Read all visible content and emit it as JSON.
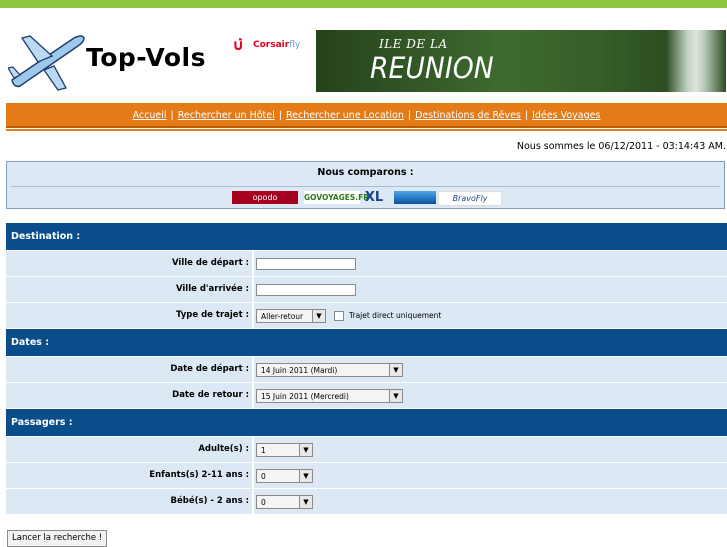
{
  "brand": {
    "logo_text": "Top-Vols"
  },
  "banner": {
    "tui_mark": "∪̇",
    "corsair": "Corsair",
    "corsair_suffix": "fly",
    "line1": "ILE DE LA",
    "line2": "REUNION"
  },
  "nav": {
    "items": [
      "Accueil",
      "Rechercher un Hôtel",
      "Rechercher une Location",
      "Destinations de Rêves",
      "Idées Voyages"
    ],
    "separator": "|"
  },
  "date_line": "Nous sommes le 06/12/2011 - 03:14:43 AM.",
  "compare": {
    "title": "Nous comparons :",
    "partners": [
      "opodo",
      "GOVOYAGES.FR",
      "XL",
      "",
      "BravoFly"
    ]
  },
  "form": {
    "sections": {
      "destination": "Destination :",
      "dates": "Dates :",
      "passagers": "Passagers :"
    },
    "ville_depart": {
      "label": "Ville de départ :",
      "value": ""
    },
    "ville_arrivee": {
      "label": "Ville d'arrivée :",
      "value": ""
    },
    "type_trajet": {
      "label": "Type de trajet :",
      "value": "Aller-retour",
      "checkbox_label": "Trajet direct uniquement"
    },
    "date_depart": {
      "label": "Date de départ :",
      "value": "14 Juin 2011 (Mardi)"
    },
    "date_retour": {
      "label": "Date de retour :",
      "value": "15 Juin 2011 (Mercredi)"
    },
    "adultes": {
      "label": "Adulte(s) :",
      "value": "1"
    },
    "enfants": {
      "label": "Enfants(s) 2-11 ans :",
      "value": "0"
    },
    "bebes": {
      "label": "Bébé(s) - 2 ans :",
      "value": "0"
    },
    "submit_label": "Lancer la recherche !"
  },
  "colors": {
    "topbar": "#8dc63f",
    "nav": "#e57b17",
    "section": "#094d8b",
    "row_bg": "#dce9f5"
  }
}
